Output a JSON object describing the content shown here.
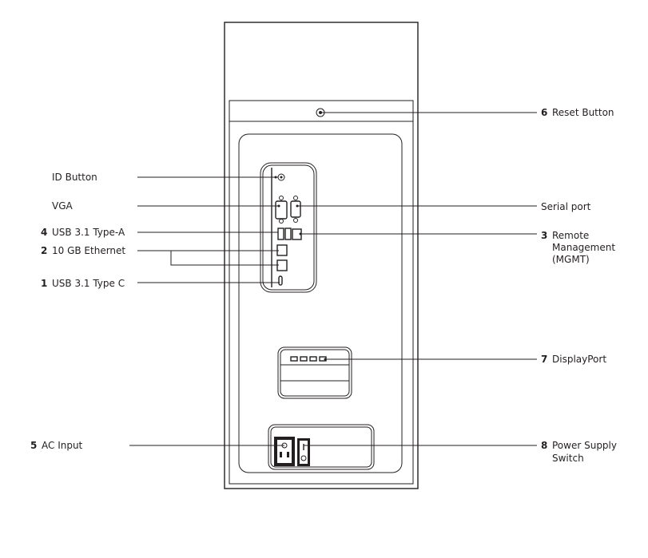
{
  "labels": {
    "reset": {
      "num": "6",
      "text": "Reset Button"
    },
    "id_button": {
      "num": "",
      "text": "ID Button"
    },
    "vga": {
      "num": "",
      "text": "VGA"
    },
    "serial": {
      "num": "",
      "text": "Serial port"
    },
    "usb_a": {
      "num": "4",
      "text": "USB 3.1 Type-A"
    },
    "mgmt": {
      "num": "3",
      "lines": [
        "Remote",
        "Management",
        "(MGMT)"
      ]
    },
    "ethernet": {
      "num": "2",
      "text": "10 GB Ethernet"
    },
    "usb_c": {
      "num": "1",
      "text": "USB 3.1 Type C"
    },
    "displayport": {
      "num": "7",
      "text": "DisplayPort"
    },
    "ac_input": {
      "num": "5",
      "text": "AC Input"
    },
    "psu_switch": {
      "num": "8",
      "lines": [
        "Power Supply",
        "Switch"
      ]
    }
  }
}
